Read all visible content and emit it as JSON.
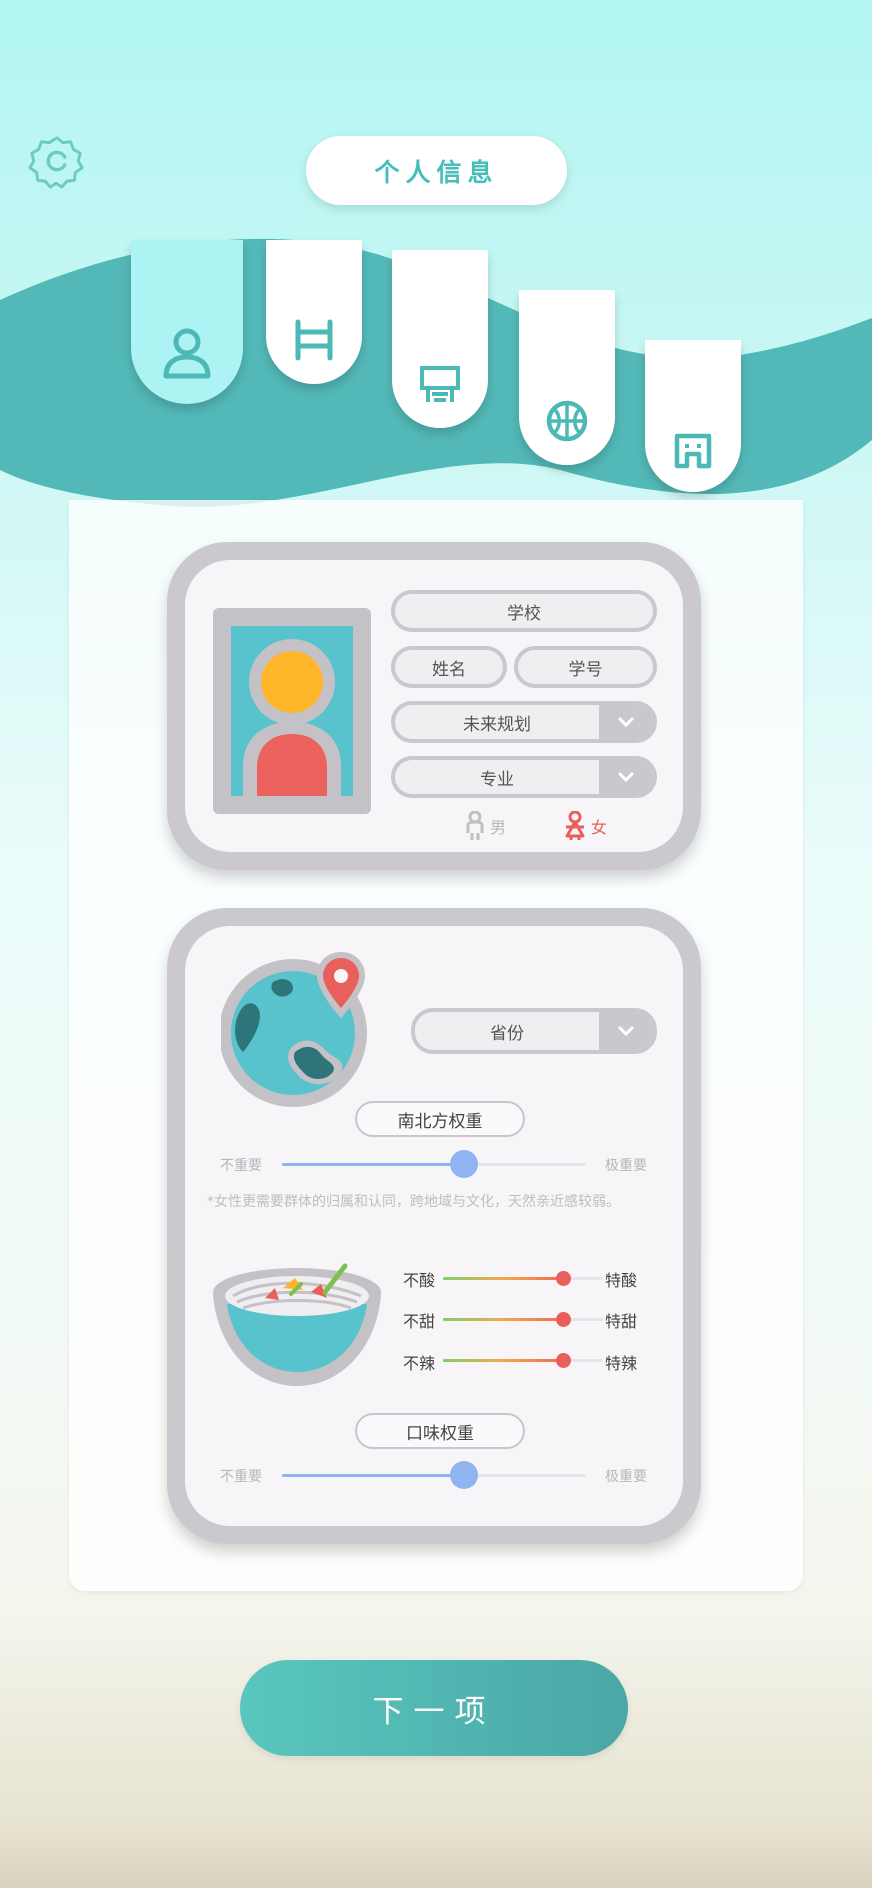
{
  "header": {
    "title": "个人信息",
    "settings_icon": "settings-icon"
  },
  "tabs": [
    {
      "icon": "person-icon",
      "active": true
    },
    {
      "icon": "bed-icon",
      "active": false
    },
    {
      "icon": "desk-icon",
      "active": false
    },
    {
      "icon": "basketball-icon",
      "active": false
    },
    {
      "icon": "door-icon",
      "active": false
    }
  ],
  "profile": {
    "school_label": "学校",
    "name_label": "姓名",
    "student_id_label": "学号",
    "future_plan_label": "未来规划",
    "major_label": "专业",
    "gender_male": "男",
    "gender_female": "女",
    "selected_gender": "女"
  },
  "region": {
    "province_label": "省份",
    "weight_label": "南北方权重",
    "slider_min": "不重要",
    "slider_max": "极重要",
    "slider_value": 0.6,
    "note": "*女性更需要群体的归属和认同，跨地域与文化，天然亲近感较弱。"
  },
  "taste": {
    "rows": [
      {
        "min": "不酸",
        "max": "特酸",
        "value": 0.75
      },
      {
        "min": "不甜",
        "max": "特甜",
        "value": 0.75
      },
      {
        "min": "不辣",
        "max": "特辣",
        "value": 0.75
      }
    ],
    "weight_label": "口味权重",
    "slider_min": "不重要",
    "slider_max": "极重要",
    "slider_value": 0.6
  },
  "footer": {
    "next_label": "下一项"
  },
  "colors": {
    "teal": "#45bdb9",
    "dark_teal": "#53b9b8",
    "accent_red": "#e95f5c",
    "slider_blue": "#8fb4f1"
  }
}
